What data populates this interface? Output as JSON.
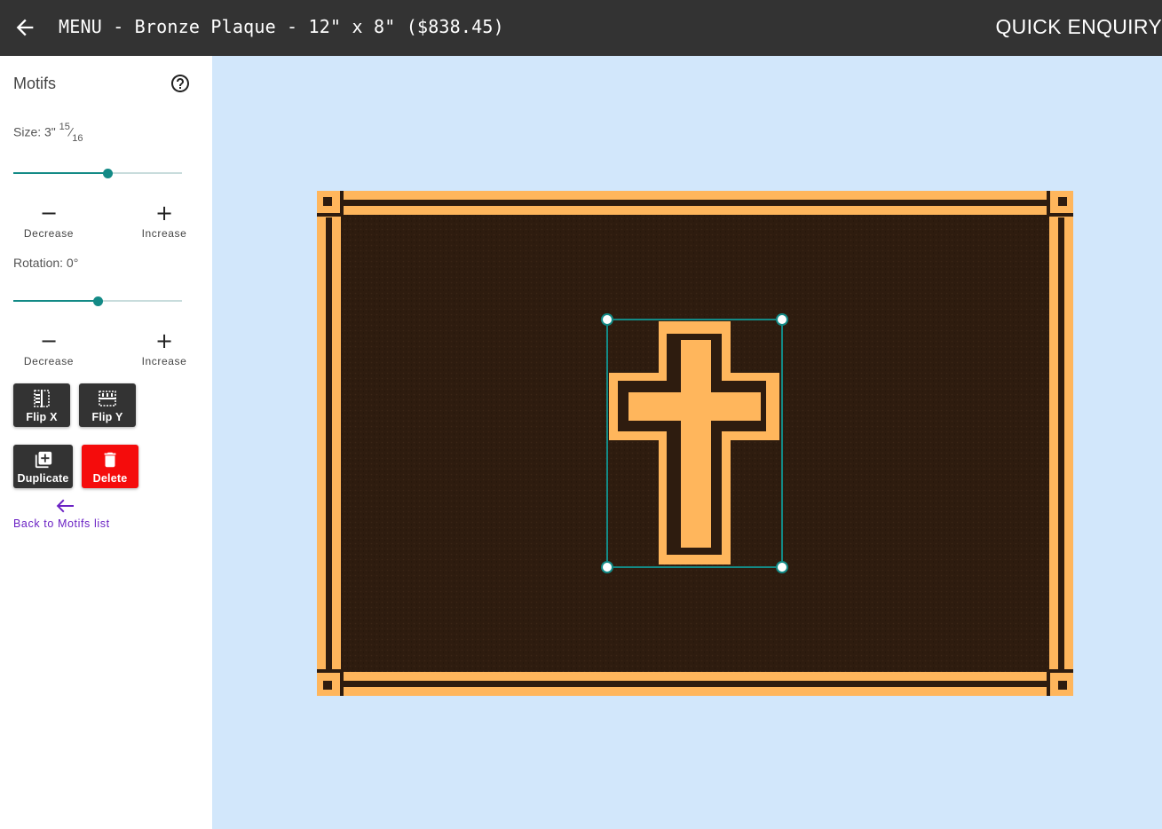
{
  "header": {
    "back_icon": "arrow-left-icon",
    "title": "MENU - Bronze Plaque - 12\" x 8\" ($838.45)",
    "quick_enquiry": "QUICK ENQUIRY"
  },
  "sidebar": {
    "title": "Motifs",
    "help_icon": "question-circle-icon",
    "size": {
      "label_prefix": "Size: 3\"",
      "fraction_num": "15",
      "fraction_sep": "⁄",
      "fraction_den": "16",
      "slider_value": 0.56,
      "decrease_symbol": "−",
      "decrease_label": "Decrease",
      "increase_symbol": "+",
      "increase_label": "Increase"
    },
    "rotation": {
      "label": "Rotation: 0°",
      "slider_value": 0.5,
      "decrease_symbol": "−",
      "decrease_label": "Decrease",
      "increase_symbol": "+",
      "increase_label": "Increase"
    },
    "buttons": {
      "flip_x": "Flip X",
      "flip_y": "Flip Y",
      "duplicate": "Duplicate",
      "delete": "Delete"
    },
    "back_link": "Back to Motifs list"
  },
  "colors": {
    "header_bg": "#333333",
    "accent": "#138a86",
    "canvas_bg": "#d2e7fb",
    "bronze_dark": "#2e1c0f",
    "bronze_gold": "#ffb65c",
    "delete_red": "#f50c0c",
    "link_purple": "#6b22c4"
  },
  "canvas": {
    "plaque_motif": "cross-icon"
  }
}
